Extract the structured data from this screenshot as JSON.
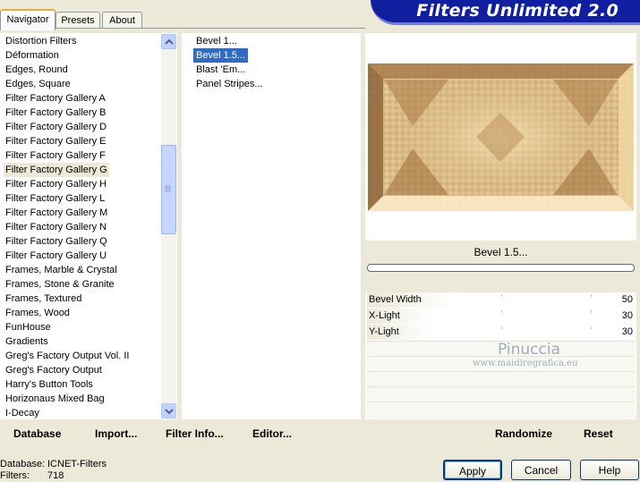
{
  "tabs": [
    "Navigator",
    "Presets",
    "About"
  ],
  "banner": "Filters Unlimited 2.0",
  "categories": [
    "Distortion Filters",
    "Déformation",
    "Edges, Round",
    "Edges, Square",
    "Filter Factory Gallery A",
    "Filter Factory Gallery B",
    "Filter Factory Gallery D",
    "Filter Factory Gallery E",
    "Filter Factory Gallery F",
    "Filter Factory Gallery G",
    "Filter Factory Gallery H",
    "Filter Factory Gallery L",
    "Filter Factory Gallery M",
    "Filter Factory Gallery N",
    "Filter Factory Gallery Q",
    "Filter Factory Gallery U",
    "Frames, Marble & Crystal",
    "Frames, Stone & Granite",
    "Frames, Textured",
    "Frames, Wood",
    "FunHouse",
    "Gradients",
    "Greg's Factory Output Vol. II",
    "Greg's Factory Output",
    "Harry's Button Tools",
    "Horizonaus Mixed Bag",
    "I-Decay"
  ],
  "selected_category": "Filter Factory Gallery G",
  "filters": [
    "Bevel 1...",
    "Bevel 1.5...",
    "Blast 'Em...",
    "Panel Stripes..."
  ],
  "selected_filter": "Bevel 1.5...",
  "filter_name": "Bevel 1.5...",
  "params": [
    {
      "label": "Bevel Width",
      "value": "50",
      "level": 50
    },
    {
      "label": "X-Light",
      "value": "30",
      "level": 30
    },
    {
      "label": "Y-Light",
      "value": "30",
      "level": 30
    }
  ],
  "watermark": {
    "name": "Pinuccia",
    "url": "www.maidiregrafica.eu"
  },
  "toolbar": {
    "database": "Database",
    "import": "Import...",
    "filter_info": "Filter Info...",
    "editor": "Editor...",
    "randomize": "Randomize",
    "reset": "Reset"
  },
  "info": {
    "database_label": "Database:",
    "database_value": "ICNET-Filters",
    "filters_label": "Filters:",
    "filters_value": "718"
  },
  "buttons": {
    "apply": "Apply",
    "cancel": "Cancel",
    "help": "Help"
  },
  "colors": {
    "selection": "#316ac5",
    "banner": "#0f1fa0",
    "tab_accent": "#f1a83c"
  }
}
